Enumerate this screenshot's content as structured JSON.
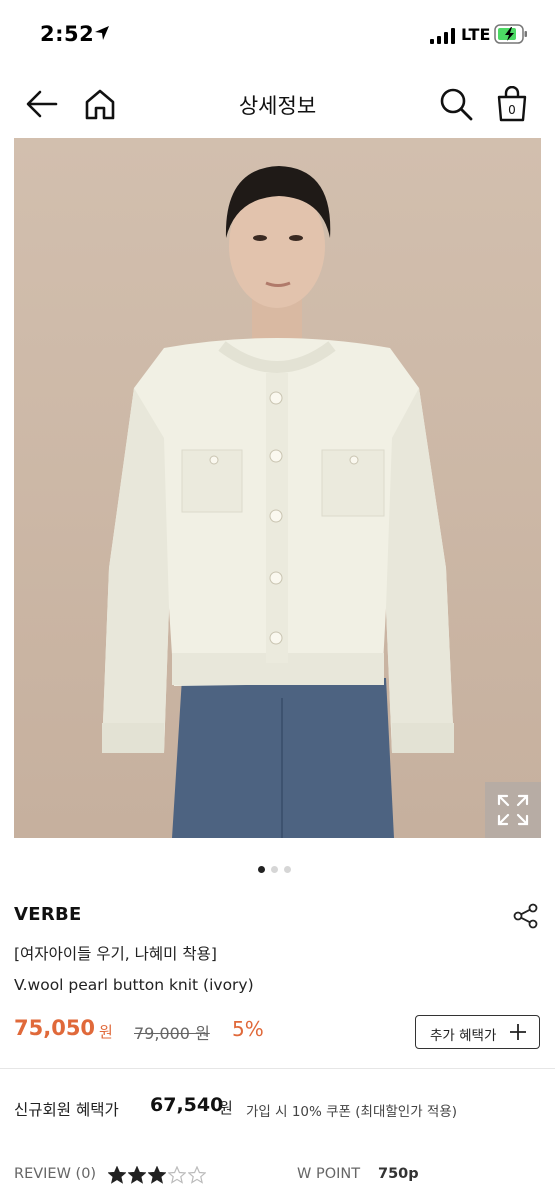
{
  "status_bar": {
    "time": "2:52",
    "network": "LTE"
  },
  "nav": {
    "title": "상세정보",
    "cart_count": "0"
  },
  "gallery": {
    "page_count": 3,
    "active_page": 1
  },
  "product": {
    "brand": "VERBE",
    "subtitle": "[여자아이들 우기, 나혜미 착용]",
    "name": "V.wool pearl button knit (ivory)",
    "sale_price": "75,050",
    "sale_unit": "원",
    "original_price": "79,000 원",
    "discount": "5%",
    "benefit_button_label": "추가 혜택가"
  },
  "member": {
    "label": "신규회원 혜택가",
    "price": "67,540",
    "unit": "원",
    "note": "가입 시 10% 쿠폰 (최대할인가 적용)"
  },
  "review": {
    "label": "REVIEW (0)",
    "rating": 3,
    "max_rating": 5,
    "wpoint_label": "W POINT",
    "wpoint_value": "750p"
  },
  "colors": {
    "accent": "#e0693a",
    "text": "#222222",
    "muted": "#666666"
  },
  "icons": [
    "back-arrow-icon",
    "home-icon",
    "search-icon",
    "shopping-bag-icon",
    "expand-icon",
    "share-icon",
    "plus-icon",
    "star-icon"
  ]
}
